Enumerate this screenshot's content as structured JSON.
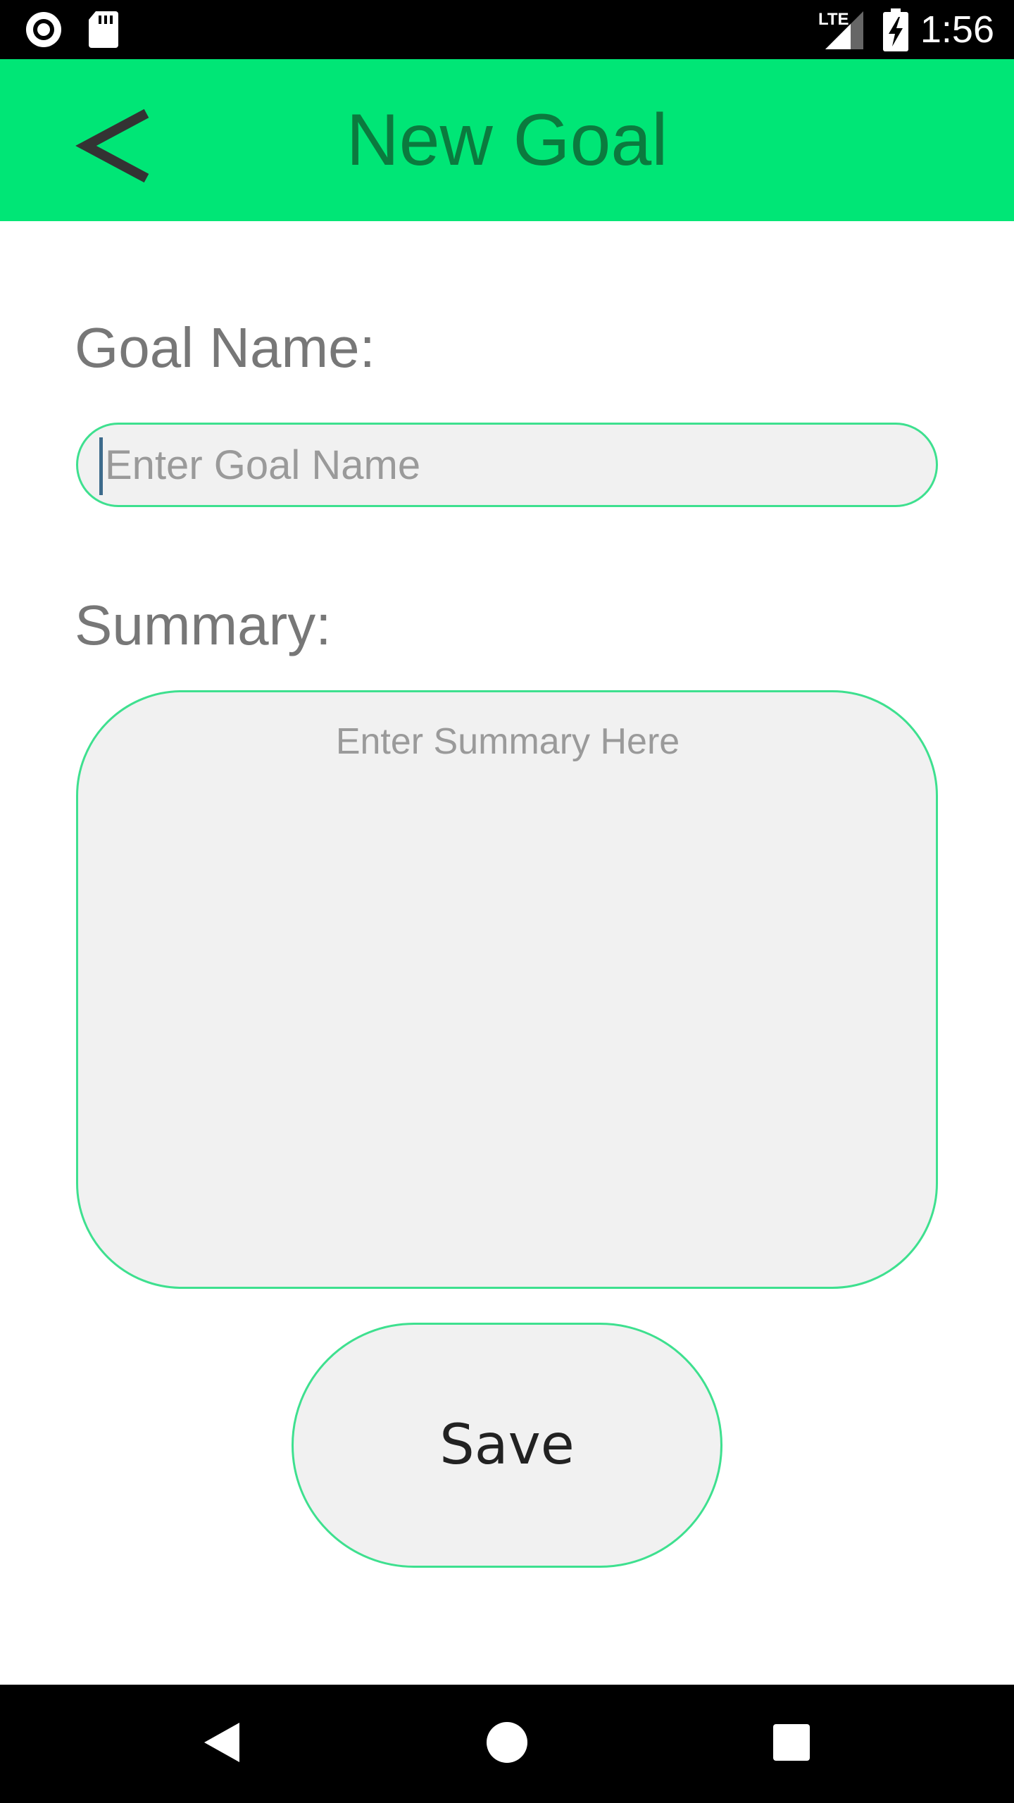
{
  "status_bar": {
    "time": "1:56",
    "network_label": "LTE",
    "left_icons": [
      "record-icon",
      "sd-card-icon"
    ],
    "right_icons": [
      "signal-icon",
      "battery-charging-icon"
    ]
  },
  "app_bar": {
    "title": "New Goal",
    "back_icon": "chevron-left-icon",
    "background_color": "#00e676",
    "title_color": "#0b7a3e"
  },
  "form": {
    "goal_name_label": "Goal Name:",
    "goal_name_value": "",
    "goal_name_placeholder": "Enter Goal Name",
    "summary_label": "Summary:",
    "summary_value": "",
    "summary_placeholder": "Enter Summary Here",
    "save_label": "Save",
    "field_border_color": "#3ee08f",
    "field_fill_color": "#f1f1f1"
  },
  "nav_bar": {
    "buttons": [
      "back-triangle-icon",
      "home-circle-icon",
      "recents-square-icon"
    ]
  }
}
